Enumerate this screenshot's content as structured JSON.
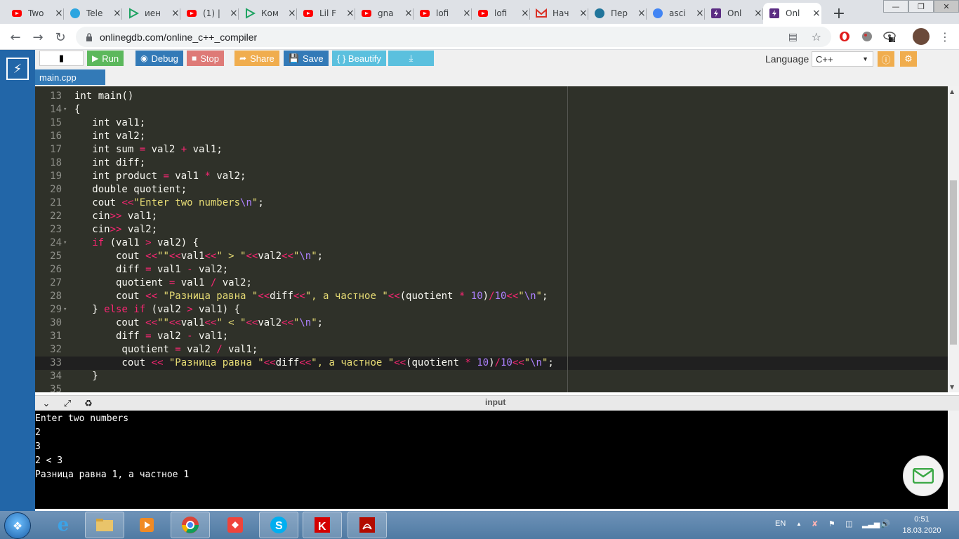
{
  "browser": {
    "tabs": [
      {
        "label": "Two",
        "icon": "youtube-icon",
        "color": "#ff0000"
      },
      {
        "label": "Tele",
        "icon": "telegram-icon",
        "color": "#2ca5e0"
      },
      {
        "label": "иен",
        "icon": "play-icon",
        "color": "#1ea362"
      },
      {
        "label": "(1) |",
        "icon": "youtube-icon",
        "color": "#ff0000"
      },
      {
        "label": "Ком",
        "icon": "play-icon",
        "color": "#1ea362"
      },
      {
        "label": "Lil F",
        "icon": "youtube-icon",
        "color": "#ff0000"
      },
      {
        "label": "gna",
        "icon": "youtube-icon",
        "color": "#ff0000"
      },
      {
        "label": "lofi",
        "icon": "youtube-icon",
        "color": "#ff0000"
      },
      {
        "label": "lofi",
        "icon": "youtube-icon",
        "color": "#ff0000"
      },
      {
        "label": "Нач",
        "icon": "gmail-icon",
        "color": "#d93025"
      },
      {
        "label": "Пер",
        "icon": "wordpress-icon",
        "color": "#21759b"
      },
      {
        "label": "asci",
        "icon": "google-icon",
        "color": "#4285f4"
      },
      {
        "label": "Onl",
        "icon": "onlinegdb-icon",
        "color": "#5b2c83"
      },
      {
        "label": "Onl",
        "icon": "onlinegdb-icon",
        "color": "#5b2c83",
        "active": true
      }
    ],
    "url": "onlinegdb.com/online_c++_compiler",
    "extension_badge": "3"
  },
  "ide": {
    "buttons": {
      "run": "Run",
      "debug": "Debug",
      "stop": "Stop",
      "share": "Share",
      "save": "Save",
      "beautify": "{ } Beautify"
    },
    "language_label": "Language",
    "language_value": "C++",
    "file_tab": "main.cpp",
    "code_lines": [
      {
        "n": "13",
        "fold": false,
        "tokens": [
          {
            "t": "int main()",
            "c": "kw"
          }
        ]
      },
      {
        "n": "14",
        "fold": true,
        "tokens": [
          {
            "t": "{",
            "c": "kw"
          }
        ]
      },
      {
        "n": "15",
        "fold": false,
        "tokens": [
          {
            "t": "   int val1;",
            "c": "kw"
          }
        ]
      },
      {
        "n": "16",
        "fold": false,
        "tokens": [
          {
            "t": "   int val2;",
            "c": "kw"
          }
        ]
      },
      {
        "n": "17",
        "fold": false,
        "tokens": [
          {
            "t": "   int sum ",
            "c": "kw"
          },
          {
            "t": "=",
            "c": "op"
          },
          {
            "t": " val2 ",
            "c": "kw"
          },
          {
            "t": "+",
            "c": "op"
          },
          {
            "t": " val1;",
            "c": "kw"
          }
        ]
      },
      {
        "n": "18",
        "fold": false,
        "tokens": [
          {
            "t": "   int diff;",
            "c": "kw"
          }
        ]
      },
      {
        "n": "19",
        "fold": false,
        "tokens": [
          {
            "t": "   int product ",
            "c": "kw"
          },
          {
            "t": "=",
            "c": "op"
          },
          {
            "t": " val1 ",
            "c": "kw"
          },
          {
            "t": "*",
            "c": "op"
          },
          {
            "t": " val2;",
            "c": "kw"
          }
        ]
      },
      {
        "n": "20",
        "fold": false,
        "tokens": [
          {
            "t": "   double quotient;",
            "c": "kw"
          }
        ]
      },
      {
        "n": "21",
        "fold": false,
        "tokens": [
          {
            "t": "   cout ",
            "c": "kw"
          },
          {
            "t": "<<",
            "c": "op"
          },
          {
            "t": "\"Enter two numbers",
            "c": "str"
          },
          {
            "t": "\\n",
            "c": "esc"
          },
          {
            "t": "\"",
            "c": "str"
          },
          {
            "t": ";",
            "c": "kw"
          }
        ]
      },
      {
        "n": "22",
        "fold": false,
        "tokens": [
          {
            "t": "   cin",
            "c": "kw"
          },
          {
            "t": ">>",
            "c": "op"
          },
          {
            "t": " val1;",
            "c": "kw"
          }
        ]
      },
      {
        "n": "23",
        "fold": false,
        "tokens": [
          {
            "t": "   cin",
            "c": "kw"
          },
          {
            "t": ">>",
            "c": "op"
          },
          {
            "t": " val2;",
            "c": "kw"
          }
        ]
      },
      {
        "n": "24",
        "fold": true,
        "tokens": [
          {
            "t": "   ",
            "c": "kw"
          },
          {
            "t": "if",
            "c": "op"
          },
          {
            "t": " (val1 ",
            "c": "kw"
          },
          {
            "t": ">",
            "c": "op"
          },
          {
            "t": " val2) {",
            "c": "kw"
          }
        ]
      },
      {
        "n": "25",
        "fold": false,
        "tokens": [
          {
            "t": "       cout ",
            "c": "kw"
          },
          {
            "t": "<<",
            "c": "op"
          },
          {
            "t": "\"\"",
            "c": "str"
          },
          {
            "t": "<<",
            "c": "op"
          },
          {
            "t": "val1",
            "c": "kw"
          },
          {
            "t": "<<",
            "c": "op"
          },
          {
            "t": "\" > \"",
            "c": "str"
          },
          {
            "t": "<<",
            "c": "op"
          },
          {
            "t": "val2",
            "c": "kw"
          },
          {
            "t": "<<",
            "c": "op"
          },
          {
            "t": "\"",
            "c": "str"
          },
          {
            "t": "\\n",
            "c": "esc"
          },
          {
            "t": "\"",
            "c": "str"
          },
          {
            "t": ";",
            "c": "kw"
          }
        ]
      },
      {
        "n": "26",
        "fold": false,
        "tokens": [
          {
            "t": "       diff ",
            "c": "kw"
          },
          {
            "t": "=",
            "c": "op"
          },
          {
            "t": " val1 ",
            "c": "kw"
          },
          {
            "t": "-",
            "c": "op"
          },
          {
            "t": " val2;",
            "c": "kw"
          }
        ]
      },
      {
        "n": "27",
        "fold": false,
        "tokens": [
          {
            "t": "       quotient ",
            "c": "kw"
          },
          {
            "t": "=",
            "c": "op"
          },
          {
            "t": " val1 ",
            "c": "kw"
          },
          {
            "t": "/",
            "c": "op"
          },
          {
            "t": " val2;",
            "c": "kw"
          }
        ]
      },
      {
        "n": "28",
        "fold": false,
        "tokens": [
          {
            "t": "       cout ",
            "c": "kw"
          },
          {
            "t": "<<",
            "c": "op"
          },
          {
            "t": " \"Разница равна \"",
            "c": "str"
          },
          {
            "t": "<<",
            "c": "op"
          },
          {
            "t": "diff",
            "c": "kw"
          },
          {
            "t": "<<",
            "c": "op"
          },
          {
            "t": "\", а частное \"",
            "c": "str"
          },
          {
            "t": "<<",
            "c": "op"
          },
          {
            "t": "(quotient ",
            "c": "kw"
          },
          {
            "t": "*",
            "c": "op"
          },
          {
            "t": " ",
            "c": "kw"
          },
          {
            "t": "10",
            "c": "num"
          },
          {
            "t": ")",
            "c": "kw"
          },
          {
            "t": "/",
            "c": "op"
          },
          {
            "t": "10",
            "c": "num"
          },
          {
            "t": "<<",
            "c": "op"
          },
          {
            "t": "\"",
            "c": "str"
          },
          {
            "t": "\\n",
            "c": "esc"
          },
          {
            "t": "\"",
            "c": "str"
          },
          {
            "t": ";",
            "c": "kw"
          }
        ]
      },
      {
        "n": "29",
        "fold": true,
        "tokens": [
          {
            "t": "   } ",
            "c": "kw"
          },
          {
            "t": "else if",
            "c": "op"
          },
          {
            "t": " (val2 ",
            "c": "kw"
          },
          {
            "t": ">",
            "c": "op"
          },
          {
            "t": " val1) {",
            "c": "kw"
          }
        ]
      },
      {
        "n": "30",
        "fold": false,
        "tokens": [
          {
            "t": "       cout ",
            "c": "kw"
          },
          {
            "t": "<<",
            "c": "op"
          },
          {
            "t": "\"\"",
            "c": "str"
          },
          {
            "t": "<<",
            "c": "op"
          },
          {
            "t": "val1",
            "c": "kw"
          },
          {
            "t": "<<",
            "c": "op"
          },
          {
            "t": "\" < \"",
            "c": "str"
          },
          {
            "t": "<<",
            "c": "op"
          },
          {
            "t": "val2",
            "c": "kw"
          },
          {
            "t": "<<",
            "c": "op"
          },
          {
            "t": "\"",
            "c": "str"
          },
          {
            "t": "\\n",
            "c": "esc"
          },
          {
            "t": "\"",
            "c": "str"
          },
          {
            "t": ";",
            "c": "kw"
          }
        ]
      },
      {
        "n": "31",
        "fold": false,
        "tokens": [
          {
            "t": "       diff ",
            "c": "kw"
          },
          {
            "t": "=",
            "c": "op"
          },
          {
            "t": " val2 ",
            "c": "kw"
          },
          {
            "t": "-",
            "c": "op"
          },
          {
            "t": " val1;",
            "c": "kw"
          }
        ]
      },
      {
        "n": "32",
        "fold": false,
        "tokens": [
          {
            "t": "        quotient ",
            "c": "kw"
          },
          {
            "t": "=",
            "c": "op"
          },
          {
            "t": " val2 ",
            "c": "kw"
          },
          {
            "t": "/",
            "c": "op"
          },
          {
            "t": " val1;",
            "c": "kw"
          }
        ]
      },
      {
        "n": "33",
        "fold": false,
        "active": true,
        "tokens": [
          {
            "t": "        cout ",
            "c": "kw"
          },
          {
            "t": "<<",
            "c": "op"
          },
          {
            "t": " \"Разница равна \"",
            "c": "str"
          },
          {
            "t": "<<",
            "c": "op"
          },
          {
            "t": "diff",
            "c": "kw"
          },
          {
            "t": "<<",
            "c": "op"
          },
          {
            "t": "\", а частное \"",
            "c": "str"
          },
          {
            "t": "<<",
            "c": "op"
          },
          {
            "t": "(quotient ",
            "c": "kw"
          },
          {
            "t": "*",
            "c": "op"
          },
          {
            "t": " ",
            "c": "kw"
          },
          {
            "t": "10",
            "c": "num"
          },
          {
            "t": ")",
            "c": "kw"
          },
          {
            "t": "/",
            "c": "op"
          },
          {
            "t": "10",
            "c": "num"
          },
          {
            "t": "<<",
            "c": "op"
          },
          {
            "t": "\"",
            "c": "str"
          },
          {
            "t": "\\n",
            "c": "esc"
          },
          {
            "t": "\"",
            "c": "str"
          },
          {
            "t": ";",
            "c": "kw"
          }
        ]
      },
      {
        "n": "34",
        "fold": false,
        "tokens": [
          {
            "t": "   }",
            "c": "kw"
          }
        ]
      },
      {
        "n": "35",
        "fold": false,
        "tokens": []
      }
    ],
    "io_title": "input",
    "console_lines": [
      "Enter two numbers",
      "2",
      "3",
      "2 < 3",
      "Разница равна 1, а частное 1"
    ]
  },
  "taskbar": {
    "language": "EN",
    "time": "0:51",
    "date": "18.03.2020"
  },
  "colors": {
    "run": "#5cb85c",
    "debug": "#337ab7",
    "stop": "#d9534f",
    "share": "#f0ad4e",
    "save": "#337ab7",
    "beautify": "#5bc0de",
    "download": "#5bc0de",
    "editor_bg": "#2f3129",
    "sidebar": "#2266a8"
  }
}
